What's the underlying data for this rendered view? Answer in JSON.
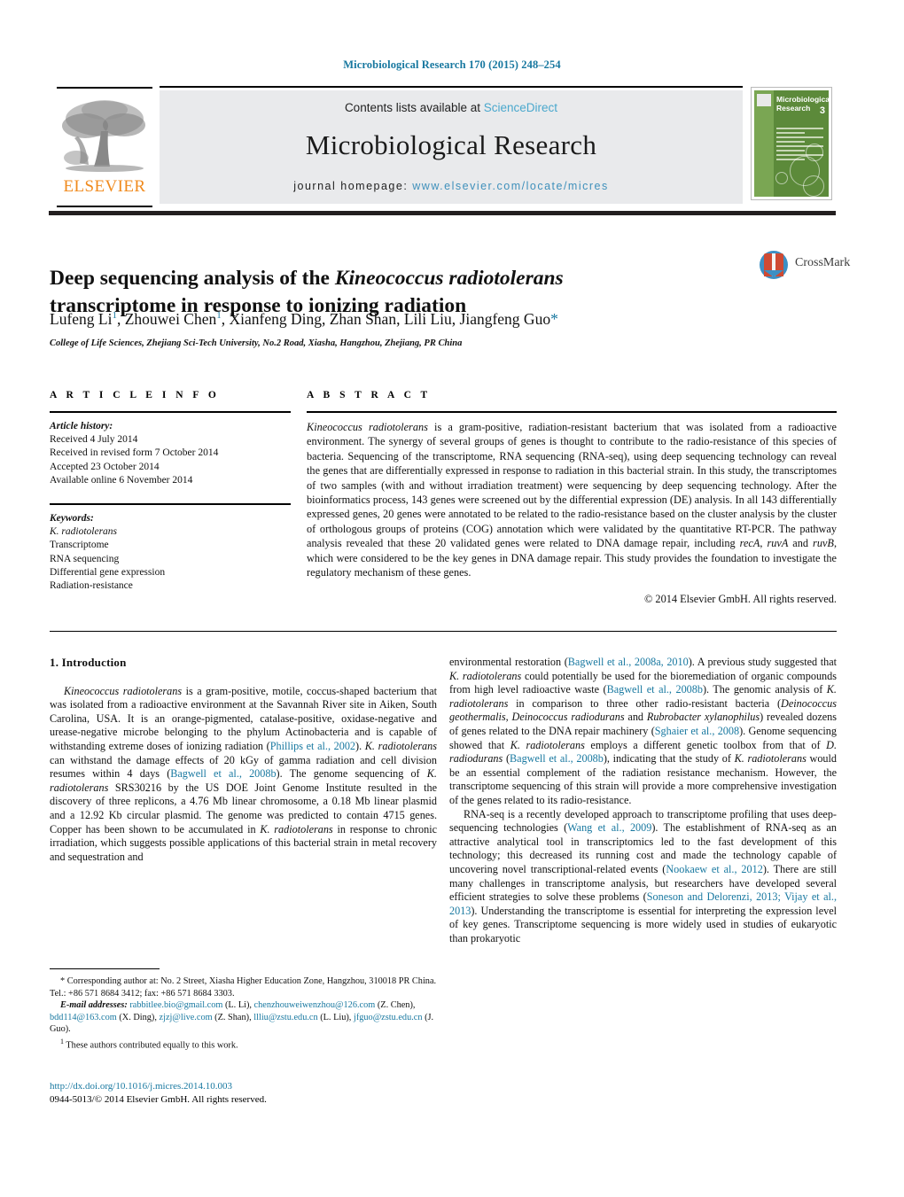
{
  "running_head": "Microbiological Research 170 (2015) 248–254",
  "masthead": {
    "contents_prefix": "Contents lists available at ",
    "sciencedirect": "ScienceDirect",
    "journal_title": "Microbiological Research",
    "homepage_label": "journal homepage: ",
    "homepage_url": "www.elsevier.com/locate/micres",
    "publisher_logo_word": "ELSEVIER",
    "accent_link_color": "#4aa8cd",
    "accent_ref_color": "#1878a0",
    "logo_orange": "#f08a1d"
  },
  "cover": {
    "title": "Microbiological Research",
    "issue_number": "3"
  },
  "article": {
    "title_part1": "Deep sequencing analysis of the ",
    "title_italic": "Kineococcus radiotolerans",
    "title_part2": " transcriptome in response to ionizing radiation",
    "authors_html": "Lufeng Li<sup>1</sup>, Zhouwei Chen<sup>1</sup>, Xianfeng Ding, Zhan Shan, Lili Liu, Jiangfeng Guo<span class=\"star\">*</span>",
    "affiliation": "College of Life Sciences, Zhejiang Sci-Tech University, No.2 Road, Xiasha, Hangzhou, Zhejiang, PR China",
    "crossmark_label": "CrossMark"
  },
  "info": {
    "heading": "A R T I C L E    I N F O",
    "history_label": "Article history:",
    "history": [
      "Received 4 July 2014",
      "Received in revised form 7 October 2014",
      "Accepted 23 October 2014",
      "Available online 6 November 2014"
    ],
    "keywords_label": "Keywords:",
    "keywords": [
      "K. radiotolerans",
      "Transcriptome",
      "RNA sequencing",
      "Differential gene expression",
      "Radiation-resistance"
    ]
  },
  "abstract": {
    "heading": "A B S T R A C T",
    "text_html": "<i>Kineococcus radiotolerans</i> is a gram-positive, radiation-resistant bacterium that was isolated from a radioactive environment. The synergy of several groups of genes is thought to contribute to the radio-resistance of this species of bacteria. Sequencing of the transcriptome, RNA sequencing (RNA-seq), using deep sequencing technology can reveal the genes that are differentially expressed in response to radiation in this bacterial strain. In this study, the transcriptomes of two samples (with and without irradiation treatment) were sequencing by deep sequencing technology. After the bioinformatics process, 143 genes were screened out by the differential expression (DE) analysis. In all 143 differentially expressed genes, 20 genes were annotated to be related to the radio-resistance based on the cluster analysis by the cluster of orthologous groups of proteins (COG) annotation which were validated by the quantitative RT-PCR. The pathway analysis revealed that these 20 validated genes were related to DNA damage repair, including <i>recA</i>, <i>ruvA</i> and <i>ruvB</i>, which were considered to be the key genes in DNA damage repair. This study provides the foundation to investigate the regulatory mechanism of these genes.",
    "copyright": "© 2014 Elsevier GmbH. All rights reserved."
  },
  "intro": {
    "heading": "1.  Introduction",
    "left_p1_html": "<i>Kineococcus radiotolerans</i> is a gram-positive, motile, coccus-shaped bacterium that was isolated from a radioactive environment at the Savannah River site in Aiken, South Carolina, USA. It is an orange-pigmented, catalase-positive, oxidase-negative and urease-negative microbe belonging to the phylum Actinobacteria and is capable of withstanding extreme doses of ionizing radiation (<a class=\"ref\" href=\"#\">Phillips et al., 2002</a>). <i>K. radiotolerans</i> can withstand the damage effects of 20 kGy of gamma radiation and cell division resumes within 4 days (<a class=\"ref\" href=\"#\">Bagwell et al., 2008b</a>). The genome sequencing of <i>K. radiotolerans</i> SRS30216 by the US DOE Joint Genome Institute resulted in the discovery of three replicons, a 4.76 Mb linear chromosome, a 0.18 Mb linear plasmid and a 12.92 Kb circular plasmid. The genome was predicted to contain 4715 genes. Copper has been shown to be accumulated in <i>K. radiotolerans</i> in response to chronic irradiation, which suggests possible applications of this bacterial strain in metal recovery and sequestration and",
    "right_p1_html": "environmental restoration (<a class=\"ref\" href=\"#\">Bagwell et al., 2008a, 2010</a>). A previous study suggested that <i>K. radiotolerans</i> could potentially be used for the bioremediation of organic compounds from high level radioactive waste (<a class=\"ref\" href=\"#\">Bagwell et al., 2008b</a>). The genomic analysis of <i>K. radiotolerans</i> in comparison to three other radio-resistant bacteria (<i>Deinococcus geothermalis</i>, <i>Deinococcus radiodurans</i> and <i>Rubrobacter xylanophilus</i>) revealed dozens of genes related to the DNA repair machinery (<a class=\"ref\" href=\"#\">Sghaier et al., 2008</a>). Genome sequencing showed that <i>K. radiotolerans</i> employs a different genetic toolbox from that of <i>D. radiodurans</i> (<a class=\"ref\" href=\"#\">Bagwell et al., 2008b</a>), indicating that the study of <i>K. radiotolerans</i> would be an essential complement of the radiation resistance mechanism. However, the transcriptome sequencing of this strain will provide a more comprehensive investigation of the genes related to its radio-resistance.",
    "right_p2_html": "RNA-seq is a recently developed approach to transcriptome profiling that uses deep-sequencing technologies (<a class=\"ref\" href=\"#\">Wang et al., 2009</a>). The establishment of RNA-seq as an attractive analytical tool in transcriptomics led to the fast development of this technology; this decreased its running cost and made the technology capable of uncovering novel transcriptional-related events (<a class=\"ref\" href=\"#\">Nookaew et al., 2012</a>). There are still many challenges in transcriptome analysis, but researchers have developed several efficient strategies to solve these problems (<a class=\"ref\" href=\"#\">Soneson and Delorenzi, 2013; Vijay et al., 2013</a>). Understanding the transcriptome is essential for interpreting the expression level of key genes. Transcriptome sequencing is more widely used in studies of eukaryotic than prokaryotic"
  },
  "footnotes": {
    "corresponding_html": "* Corresponding author at: No. 2 Street, Xiasha Higher Education Zone, Hangzhou, 310018 PR China. Tel.: +86 571 8684 3412; fax: +86 571 8684 3303.",
    "emails_html": "<span class=\"eml-lbl\">E-mail addresses:</span> <span class=\"mail\">rabbitlee.bio@gmail.com</span> (L. Li), <span class=\"mail\">chenzhouweiwenzhou@126.com</span> (Z. Chen), <span class=\"mail\">bdd114@163.com</span> (X. Ding), <span class=\"mail\">zjzj@live.com</span> (Z. Shan), <span class=\"mail\">llliu@zstu.edu.cn</span> (L. Liu), <span class=\"mail\">jfguo@zstu.edu.cn</span> (J. Guo).",
    "equal_contrib_html": "<sup>1</sup>  These authors contributed equally to this work."
  },
  "doi_block": {
    "doi": "http://dx.doi.org/10.1016/j.micres.2014.10.003",
    "issn_line": "0944-5013/© 2014 Elsevier GmbH. All rights reserved."
  }
}
